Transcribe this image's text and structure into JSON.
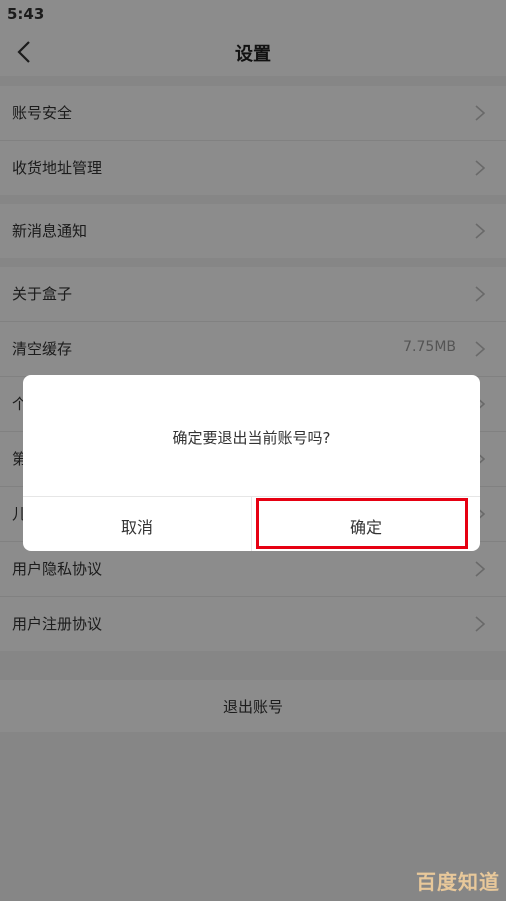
{
  "status_bar": {
    "time": "5:43"
  },
  "header": {
    "title": "设置"
  },
  "groups": [
    {
      "items": [
        {
          "label": "账号安全"
        },
        {
          "label": "收货地址管理"
        }
      ]
    },
    {
      "items": [
        {
          "label": "新消息通知"
        }
      ]
    },
    {
      "items": [
        {
          "label": "关于盒子"
        },
        {
          "label": "清空缓存",
          "value": "7.75MB"
        },
        {
          "label": "个"
        },
        {
          "label": "第"
        },
        {
          "label": "儿"
        },
        {
          "label": "用户隐私协议"
        },
        {
          "label": "用户注册协议"
        }
      ]
    }
  ],
  "logout": {
    "label": "退出账号"
  },
  "dialog": {
    "message": "确定要退出当前账号吗?",
    "cancel": "取消",
    "confirm": "确定"
  },
  "watermark": {
    "text": "百度知道"
  },
  "colors": {
    "highlight": "#e60012",
    "overlay": "rgba(0,0,0,0.45)"
  }
}
